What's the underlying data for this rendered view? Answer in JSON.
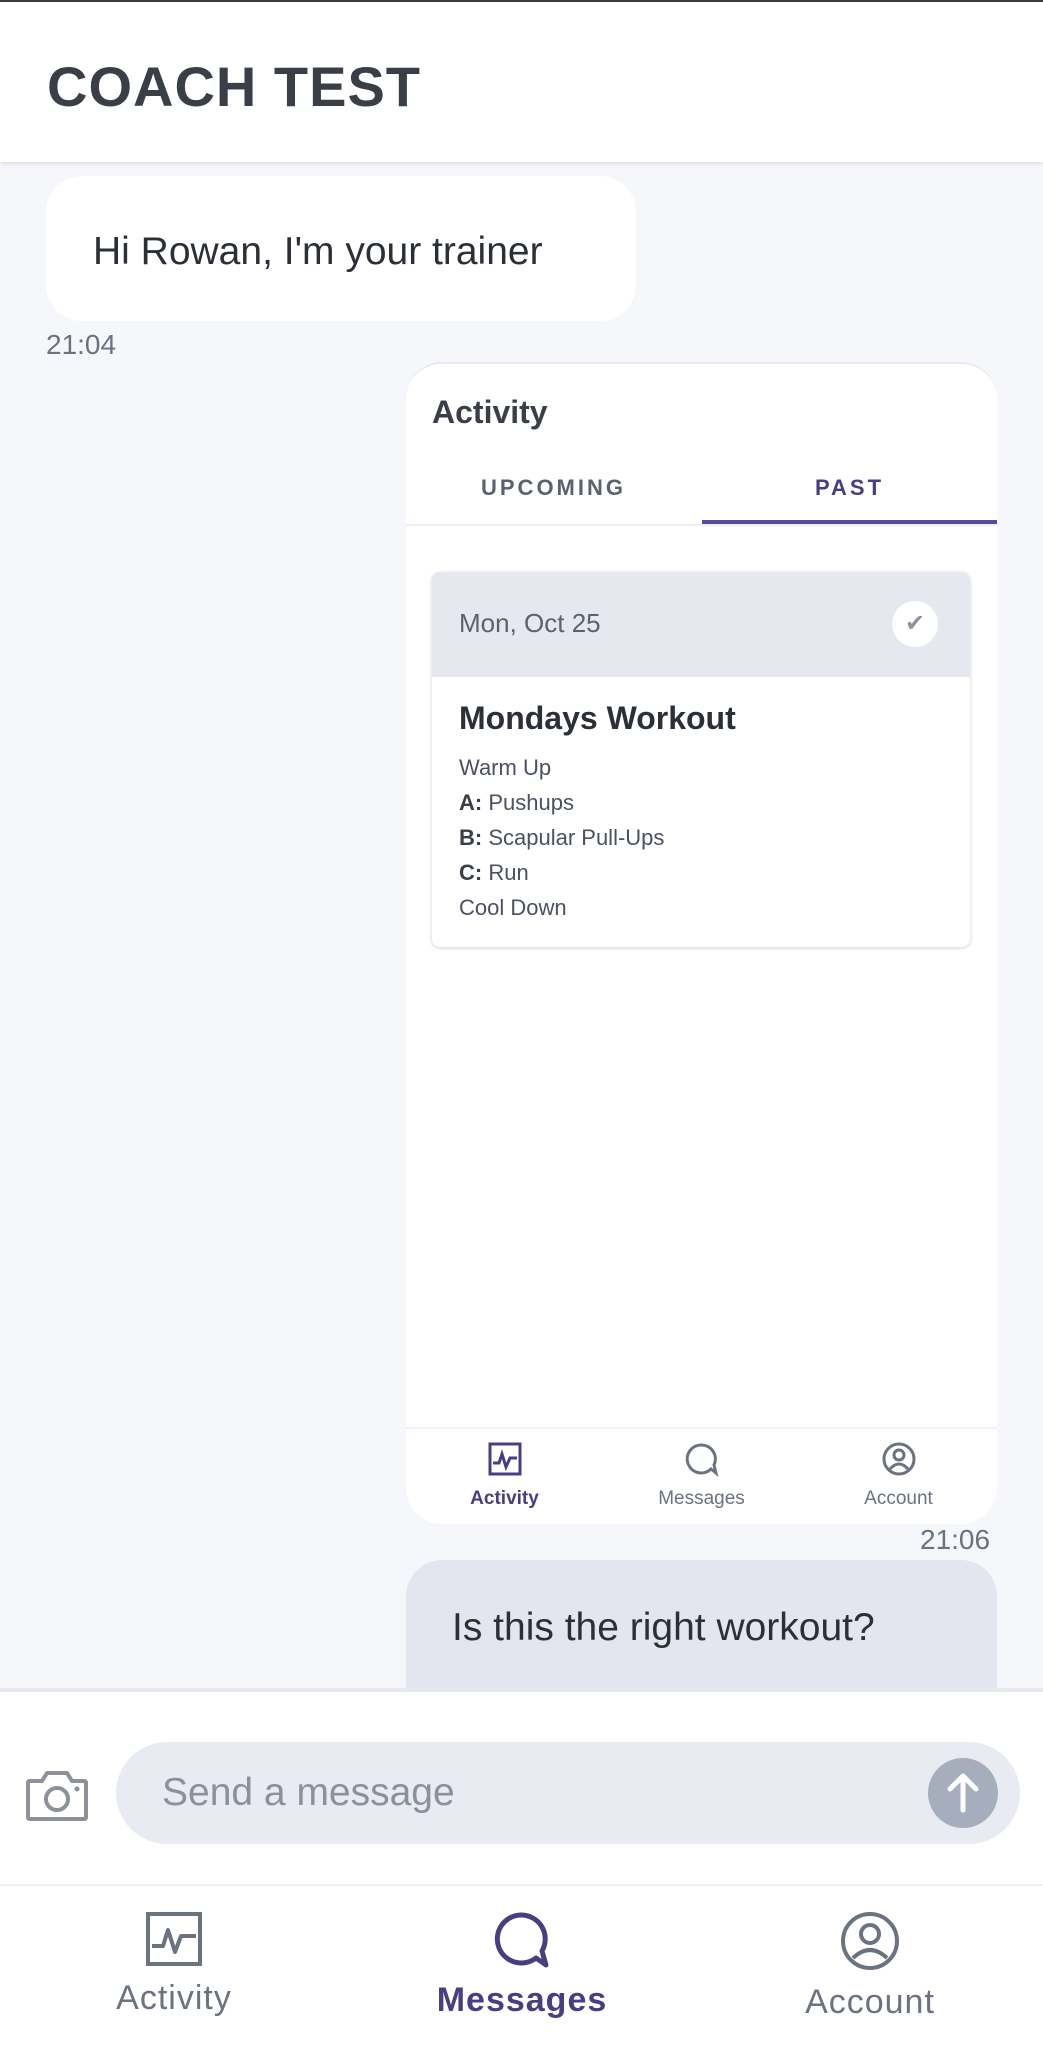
{
  "header": {
    "title": "COACH TEST"
  },
  "messages": {
    "incoming_text": "Hi Rowan, I'm your trainer",
    "incoming_time": "21:04",
    "screenshot_time": "21:06",
    "outgoing_text": "Is this the right workout?"
  },
  "shared_screenshot": {
    "title": "Activity",
    "tabs": [
      "UPCOMING",
      "PAST"
    ],
    "active_tab": "PAST",
    "card": {
      "date": "Mon, Oct 25",
      "name": "Mondays Workout",
      "lines": [
        {
          "prefix": "",
          "text": "Warm Up"
        },
        {
          "prefix": "A:",
          "text": " Pushups"
        },
        {
          "prefix": "B:",
          "text": " Scapular Pull-Ups"
        },
        {
          "prefix": "C:",
          "text": " Run"
        },
        {
          "prefix": "",
          "text": "Cool Down"
        }
      ]
    },
    "nav": [
      {
        "label": "Activity",
        "icon": "activity-icon"
      },
      {
        "label": "Messages",
        "icon": "chat-bubble-icon"
      },
      {
        "label": "Account",
        "icon": "account-icon"
      }
    ],
    "active_nav": "Activity"
  },
  "composer": {
    "placeholder": "Send a message"
  },
  "bottom_nav": {
    "items": [
      {
        "label": "Activity",
        "icon": "activity-icon"
      },
      {
        "label": "Messages",
        "icon": "chat-bubble-icon"
      },
      {
        "label": "Account",
        "icon": "account-icon"
      }
    ],
    "active": "Messages"
  },
  "colors": {
    "accent": "#4a3d80",
    "send_button": "#a6adbd",
    "outgoing_bubble": "#e3e6ee"
  }
}
